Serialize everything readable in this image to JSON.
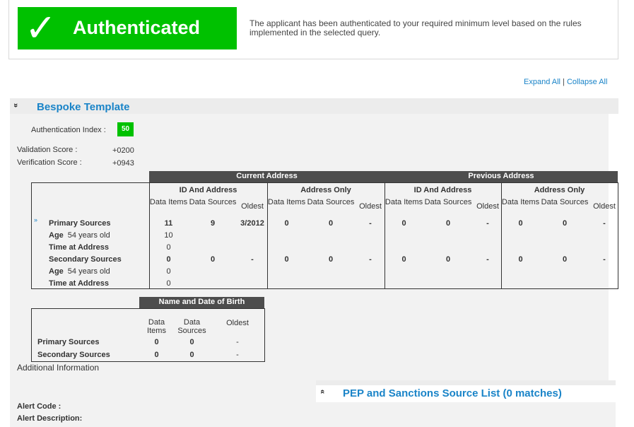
{
  "banner": {
    "check_glyph": "✓",
    "status": "Authenticated",
    "description": "The applicant has been authenticated to your required minimum level based on the rules implemented in the selected query."
  },
  "links": {
    "expand_all": "Expand All",
    "separator": "|",
    "collapse_all": "Collapse All"
  },
  "section": {
    "chevron": "»",
    "title": "Bespoke Template"
  },
  "scores": {
    "auth_index_label": "Authentication Index :",
    "auth_index_value": "50",
    "validation_label": "Validation Score :",
    "validation_value": "+0200",
    "verification_label": "Verification Score :",
    "verification_value": "+0943"
  },
  "address_table": {
    "group_headers": [
      "Current Address",
      "Previous Address"
    ],
    "sub_headers": [
      "ID And Address",
      "Address Only",
      "ID And Address",
      "Address Only"
    ],
    "col_headers": [
      "Data Items",
      "Data Sources",
      "Oldest"
    ],
    "expand_glyph": "»",
    "rows": [
      {
        "label": "Primary Sources",
        "sub": "",
        "bold": true,
        "cells": [
          "11",
          "9",
          "3/2012",
          "0",
          "0",
          "-",
          "0",
          "0",
          "-",
          "0",
          "0",
          "-"
        ]
      },
      {
        "label": "Age",
        "sub": "54 years old",
        "bold": false,
        "cells": [
          "10",
          "",
          "",
          "",
          "",
          "",
          "",
          "",
          "",
          "",
          "",
          ""
        ]
      },
      {
        "label": "Time at Address",
        "sub": "",
        "bold": false,
        "cells": [
          "0",
          "",
          "",
          "",
          "",
          "",
          "",
          "",
          "",
          "",
          "",
          ""
        ]
      },
      {
        "label": "Secondary Sources",
        "sub": "",
        "bold": true,
        "cells": [
          "0",
          "0",
          "-",
          "0",
          "0",
          "-",
          "0",
          "0",
          "-",
          "0",
          "0",
          "-"
        ]
      },
      {
        "label": "Age",
        "sub": "54 years old",
        "bold": false,
        "cells": [
          "0",
          "",
          "",
          "",
          "",
          "",
          "",
          "",
          "",
          "",
          "",
          ""
        ]
      },
      {
        "label": "Time at Address",
        "sub": "",
        "bold": false,
        "cells": [
          "0",
          "",
          "",
          "",
          "",
          "",
          "",
          "",
          "",
          "",
          "",
          ""
        ]
      }
    ]
  },
  "dob_table": {
    "header": "Name and Date of Birth",
    "col_headers": [
      "Data Items",
      "Data Sources",
      "Oldest"
    ],
    "rows": [
      {
        "label": "Primary Sources",
        "cells": [
          "0",
          "0",
          "-"
        ]
      },
      {
        "label": "Secondary Sources",
        "cells": [
          "0",
          "0",
          "-"
        ]
      }
    ]
  },
  "additional_info": "Additional Information",
  "pep": {
    "chevron": "«",
    "title": "PEP and Sanctions Source List (0 matches)"
  },
  "alert": {
    "code_label": "Alert Code :",
    "description_label": "Alert Description:"
  }
}
